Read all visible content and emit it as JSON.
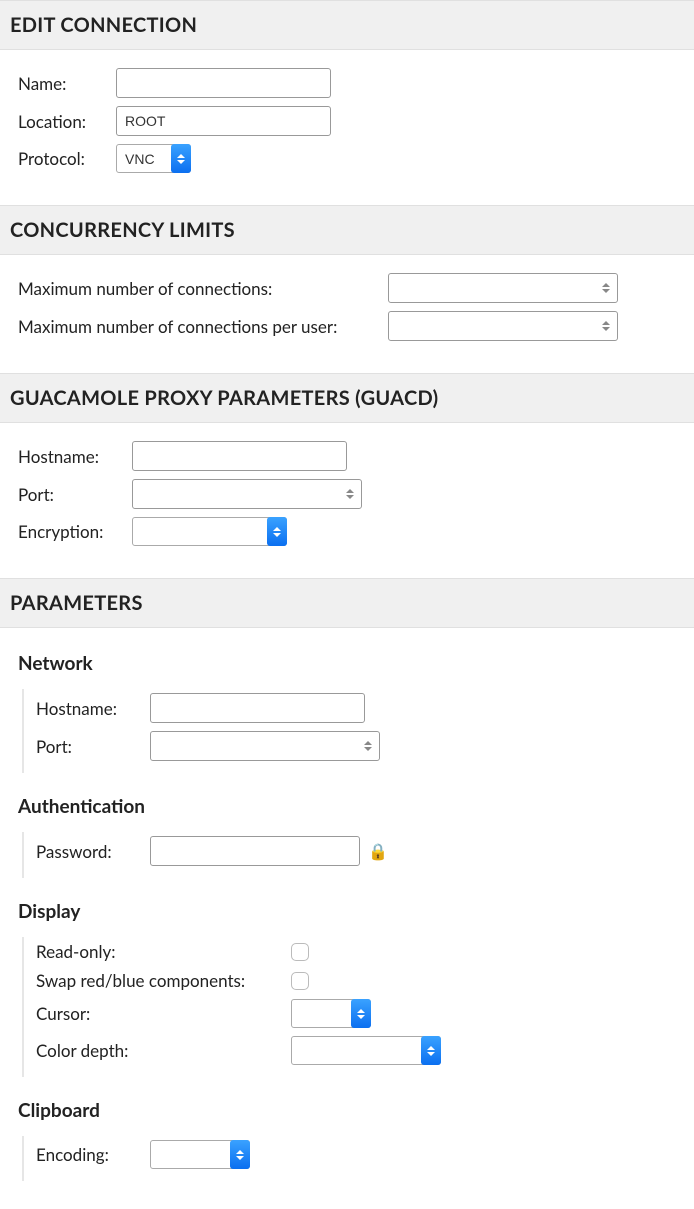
{
  "sections": {
    "edit": {
      "title": "EDIT CONNECTION",
      "name_label": "Name:",
      "name_value": "",
      "location_label": "Location:",
      "location_value": "ROOT",
      "protocol_label": "Protocol:",
      "protocol_value": "VNC"
    },
    "concurrency": {
      "title": "CONCURRENCY LIMITS",
      "max_conn_label": "Maximum number of connections:",
      "max_conn_value": "",
      "max_conn_user_label": "Maximum number of connections per user:",
      "max_conn_user_value": ""
    },
    "guacd": {
      "title": "GUACAMOLE PROXY PARAMETERS (GUACD)",
      "hostname_label": "Hostname:",
      "hostname_value": "",
      "port_label": "Port:",
      "port_value": "",
      "encryption_label": "Encryption:",
      "encryption_value": ""
    },
    "parameters": {
      "title": "PARAMETERS",
      "network": {
        "title": "Network",
        "hostname_label": "Hostname:",
        "hostname_value": "",
        "port_label": "Port:",
        "port_value": ""
      },
      "auth": {
        "title": "Authentication",
        "password_label": "Password:",
        "password_value": ""
      },
      "display": {
        "title": "Display",
        "readonly_label": "Read-only:",
        "readonly_value": false,
        "swap_label": "Swap red/blue components:",
        "swap_value": false,
        "cursor_label": "Cursor:",
        "cursor_value": "",
        "colordepth_label": "Color depth:",
        "colordepth_value": ""
      },
      "clipboard": {
        "title": "Clipboard",
        "encoding_label": "Encoding:",
        "encoding_value": ""
      }
    }
  }
}
